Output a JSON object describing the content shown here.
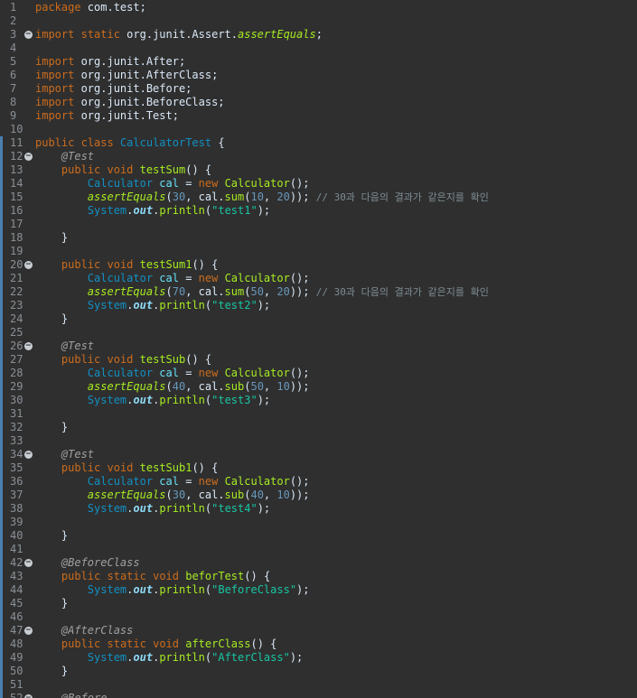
{
  "colors": {
    "keyword": "#cc6c1d",
    "plain": "#d9e8f7",
    "type": "#1290c3",
    "variable": "#66e1f8",
    "method": "#a7ec21",
    "static_method": "#a7ec21",
    "static_field": "#8ddaf8",
    "annotation": "#a0a0a0",
    "number": "#6897bb",
    "string": "#17c6a3",
    "comment": "#7d8c93",
    "line_number": "#8a9096",
    "background": "#2f2f2f",
    "fold_marker": "#c9ced3",
    "change_marker": "#4a7fb0"
  },
  "editor": {
    "lines": [
      {
        "n": "1",
        "fold": false,
        "tokens": [
          [
            "package",
            "keyword"
          ],
          [
            " com.test;",
            "plain"
          ]
        ]
      },
      {
        "n": "2",
        "fold": false,
        "tokens": []
      },
      {
        "n": "3",
        "fold": true,
        "tokens": [
          [
            "import",
            "keyword"
          ],
          [
            " ",
            "plain"
          ],
          [
            "static",
            "keyword"
          ],
          [
            " org.junit.Assert.",
            "plain"
          ],
          [
            "assertEquals",
            "static_method"
          ],
          [
            ";",
            "plain"
          ]
        ]
      },
      {
        "n": "4",
        "fold": false,
        "tokens": []
      },
      {
        "n": "5",
        "fold": false,
        "tokens": [
          [
            "import",
            "keyword"
          ],
          [
            " org.junit.After;",
            "plain"
          ]
        ]
      },
      {
        "n": "6",
        "fold": false,
        "tokens": [
          [
            "import",
            "keyword"
          ],
          [
            " org.junit.AfterClass;",
            "plain"
          ]
        ]
      },
      {
        "n": "7",
        "fold": false,
        "tokens": [
          [
            "import",
            "keyword"
          ],
          [
            " org.junit.Before;",
            "plain"
          ]
        ]
      },
      {
        "n": "8",
        "fold": false,
        "tokens": [
          [
            "import",
            "keyword"
          ],
          [
            " org.junit.BeforeClass;",
            "plain"
          ]
        ]
      },
      {
        "n": "9",
        "fold": false,
        "tokens": [
          [
            "import",
            "keyword"
          ],
          [
            " org.junit.Test;",
            "plain"
          ]
        ]
      },
      {
        "n": "10",
        "fold": false,
        "tokens": []
      },
      {
        "n": "11",
        "fold": false,
        "tokens": [
          [
            "public",
            "keyword"
          ],
          [
            " ",
            "plain"
          ],
          [
            "class",
            "keyword"
          ],
          [
            " ",
            "plain"
          ],
          [
            "CalculatorTest",
            "type"
          ],
          [
            " {",
            "plain"
          ]
        ]
      },
      {
        "n": "12",
        "fold": true,
        "tokens": [
          [
            "    ",
            "plain"
          ],
          [
            "@Test",
            "annotation"
          ]
        ]
      },
      {
        "n": "13",
        "fold": false,
        "tokens": [
          [
            "    ",
            "plain"
          ],
          [
            "public",
            "keyword"
          ],
          [
            " ",
            "plain"
          ],
          [
            "void",
            "keyword"
          ],
          [
            " ",
            "plain"
          ],
          [
            "testSum",
            "method"
          ],
          [
            "() {",
            "plain"
          ]
        ]
      },
      {
        "n": "14",
        "fold": false,
        "tokens": [
          [
            "        ",
            "plain"
          ],
          [
            "Calculator",
            "type"
          ],
          [
            " ",
            "plain"
          ],
          [
            "cal",
            "variable"
          ],
          [
            " = ",
            "plain"
          ],
          [
            "new",
            "keyword"
          ],
          [
            " ",
            "plain"
          ],
          [
            "Calculator",
            "method"
          ],
          [
            "();",
            "plain"
          ]
        ]
      },
      {
        "n": "15",
        "fold": false,
        "tokens": [
          [
            "        ",
            "plain"
          ],
          [
            "assertEquals",
            "static_method"
          ],
          [
            "(",
            "plain"
          ],
          [
            "30",
            "number"
          ],
          [
            ", cal.",
            "plain"
          ],
          [
            "sum",
            "method"
          ],
          [
            "(",
            "plain"
          ],
          [
            "10",
            "number"
          ],
          [
            ", ",
            "plain"
          ],
          [
            "20",
            "number"
          ],
          [
            ")); ",
            "plain"
          ],
          [
            "// 30과 다음의 결과가 같은지를 확인",
            "comment"
          ]
        ]
      },
      {
        "n": "16",
        "fold": false,
        "tokens": [
          [
            "        ",
            "plain"
          ],
          [
            "System",
            "type"
          ],
          [
            ".",
            "plain"
          ],
          [
            "out",
            "static_field"
          ],
          [
            ".",
            "plain"
          ],
          [
            "println",
            "method"
          ],
          [
            "(",
            "plain"
          ],
          [
            "\"test1\"",
            "string"
          ],
          [
            ");",
            "plain"
          ]
        ]
      },
      {
        "n": "17",
        "fold": false,
        "tokens": []
      },
      {
        "n": "18",
        "fold": false,
        "tokens": [
          [
            "    }",
            "plain"
          ]
        ]
      },
      {
        "n": "19",
        "fold": false,
        "tokens": []
      },
      {
        "n": "20",
        "fold": true,
        "tokens": [
          [
            "    ",
            "plain"
          ],
          [
            "public",
            "keyword"
          ],
          [
            " ",
            "plain"
          ],
          [
            "void",
            "keyword"
          ],
          [
            " ",
            "plain"
          ],
          [
            "testSum1",
            "method"
          ],
          [
            "() {",
            "plain"
          ]
        ]
      },
      {
        "n": "21",
        "fold": false,
        "tokens": [
          [
            "        ",
            "plain"
          ],
          [
            "Calculator",
            "type"
          ],
          [
            " ",
            "plain"
          ],
          [
            "cal",
            "variable"
          ],
          [
            " = ",
            "plain"
          ],
          [
            "new",
            "keyword"
          ],
          [
            " ",
            "plain"
          ],
          [
            "Calculator",
            "method"
          ],
          [
            "();",
            "plain"
          ]
        ]
      },
      {
        "n": "22",
        "fold": false,
        "tokens": [
          [
            "        ",
            "plain"
          ],
          [
            "assertEquals",
            "static_method"
          ],
          [
            "(",
            "plain"
          ],
          [
            "70",
            "number"
          ],
          [
            ", cal.",
            "plain"
          ],
          [
            "sum",
            "method"
          ],
          [
            "(",
            "plain"
          ],
          [
            "50",
            "number"
          ],
          [
            ", ",
            "plain"
          ],
          [
            "20",
            "number"
          ],
          [
            ")); ",
            "plain"
          ],
          [
            "// 30과 다음의 결과가 같은지를 확인",
            "comment"
          ]
        ]
      },
      {
        "n": "23",
        "fold": false,
        "tokens": [
          [
            "        ",
            "plain"
          ],
          [
            "System",
            "type"
          ],
          [
            ".",
            "plain"
          ],
          [
            "out",
            "static_field"
          ],
          [
            ".",
            "plain"
          ],
          [
            "println",
            "method"
          ],
          [
            "(",
            "plain"
          ],
          [
            "\"test2\"",
            "string"
          ],
          [
            ");",
            "plain"
          ]
        ]
      },
      {
        "n": "24",
        "fold": false,
        "tokens": [
          [
            "    }",
            "plain"
          ]
        ]
      },
      {
        "n": "25",
        "fold": false,
        "tokens": []
      },
      {
        "n": "26",
        "fold": true,
        "tokens": [
          [
            "    ",
            "plain"
          ],
          [
            "@Test",
            "annotation"
          ]
        ]
      },
      {
        "n": "27",
        "fold": false,
        "tokens": [
          [
            "    ",
            "plain"
          ],
          [
            "public",
            "keyword"
          ],
          [
            " ",
            "plain"
          ],
          [
            "void",
            "keyword"
          ],
          [
            " ",
            "plain"
          ],
          [
            "testSub",
            "method"
          ],
          [
            "() {",
            "plain"
          ]
        ]
      },
      {
        "n": "28",
        "fold": false,
        "tokens": [
          [
            "        ",
            "plain"
          ],
          [
            "Calculator",
            "type"
          ],
          [
            " ",
            "plain"
          ],
          [
            "cal",
            "variable"
          ],
          [
            " = ",
            "plain"
          ],
          [
            "new",
            "keyword"
          ],
          [
            " ",
            "plain"
          ],
          [
            "Calculator",
            "method"
          ],
          [
            "();",
            "plain"
          ]
        ]
      },
      {
        "n": "29",
        "fold": false,
        "tokens": [
          [
            "        ",
            "plain"
          ],
          [
            "assertEquals",
            "static_method"
          ],
          [
            "(",
            "plain"
          ],
          [
            "40",
            "number"
          ],
          [
            ", cal.",
            "plain"
          ],
          [
            "sub",
            "method"
          ],
          [
            "(",
            "plain"
          ],
          [
            "50",
            "number"
          ],
          [
            ", ",
            "plain"
          ],
          [
            "10",
            "number"
          ],
          [
            "));",
            "plain"
          ]
        ]
      },
      {
        "n": "30",
        "fold": false,
        "tokens": [
          [
            "        ",
            "plain"
          ],
          [
            "System",
            "type"
          ],
          [
            ".",
            "plain"
          ],
          [
            "out",
            "static_field"
          ],
          [
            ".",
            "plain"
          ],
          [
            "println",
            "method"
          ],
          [
            "(",
            "plain"
          ],
          [
            "\"test3\"",
            "string"
          ],
          [
            ");",
            "plain"
          ]
        ]
      },
      {
        "n": "31",
        "fold": false,
        "tokens": []
      },
      {
        "n": "32",
        "fold": false,
        "tokens": [
          [
            "    }",
            "plain"
          ]
        ]
      },
      {
        "n": "33",
        "fold": false,
        "tokens": []
      },
      {
        "n": "34",
        "fold": true,
        "tokens": [
          [
            "    ",
            "plain"
          ],
          [
            "@Test",
            "annotation"
          ]
        ]
      },
      {
        "n": "35",
        "fold": false,
        "tokens": [
          [
            "    ",
            "plain"
          ],
          [
            "public",
            "keyword"
          ],
          [
            " ",
            "plain"
          ],
          [
            "void",
            "keyword"
          ],
          [
            " ",
            "plain"
          ],
          [
            "testSub1",
            "method"
          ],
          [
            "() {",
            "plain"
          ]
        ]
      },
      {
        "n": "36",
        "fold": false,
        "tokens": [
          [
            "        ",
            "plain"
          ],
          [
            "Calculator",
            "type"
          ],
          [
            " ",
            "plain"
          ],
          [
            "cal",
            "variable"
          ],
          [
            " = ",
            "plain"
          ],
          [
            "new",
            "keyword"
          ],
          [
            " ",
            "plain"
          ],
          [
            "Calculator",
            "method"
          ],
          [
            "();",
            "plain"
          ]
        ]
      },
      {
        "n": "37",
        "fold": false,
        "tokens": [
          [
            "        ",
            "plain"
          ],
          [
            "assertEquals",
            "static_method"
          ],
          [
            "(",
            "plain"
          ],
          [
            "30",
            "number"
          ],
          [
            ", cal.",
            "plain"
          ],
          [
            "sub",
            "method"
          ],
          [
            "(",
            "plain"
          ],
          [
            "40",
            "number"
          ],
          [
            ", ",
            "plain"
          ],
          [
            "10",
            "number"
          ],
          [
            "));",
            "plain"
          ]
        ]
      },
      {
        "n": "38",
        "fold": false,
        "tokens": [
          [
            "        ",
            "plain"
          ],
          [
            "System",
            "type"
          ],
          [
            ".",
            "plain"
          ],
          [
            "out",
            "static_field"
          ],
          [
            ".",
            "plain"
          ],
          [
            "println",
            "method"
          ],
          [
            "(",
            "plain"
          ],
          [
            "\"test4\"",
            "string"
          ],
          [
            ");",
            "plain"
          ]
        ]
      },
      {
        "n": "39",
        "fold": false,
        "tokens": []
      },
      {
        "n": "40",
        "fold": false,
        "tokens": [
          [
            "    }",
            "plain"
          ]
        ]
      },
      {
        "n": "41",
        "fold": false,
        "tokens": []
      },
      {
        "n": "42",
        "fold": true,
        "tokens": [
          [
            "    ",
            "plain"
          ],
          [
            "@BeforeClass",
            "annotation"
          ]
        ]
      },
      {
        "n": "43",
        "fold": false,
        "tokens": [
          [
            "    ",
            "plain"
          ],
          [
            "public",
            "keyword"
          ],
          [
            " ",
            "plain"
          ],
          [
            "static",
            "keyword"
          ],
          [
            " ",
            "plain"
          ],
          [
            "void",
            "keyword"
          ],
          [
            " ",
            "plain"
          ],
          [
            "beforTest",
            "method"
          ],
          [
            "() {",
            "plain"
          ]
        ]
      },
      {
        "n": "44",
        "fold": false,
        "tokens": [
          [
            "        ",
            "plain"
          ],
          [
            "System",
            "type"
          ],
          [
            ".",
            "plain"
          ],
          [
            "out",
            "static_field"
          ],
          [
            ".",
            "plain"
          ],
          [
            "println",
            "method"
          ],
          [
            "(",
            "plain"
          ],
          [
            "\"BeforeClass\"",
            "string"
          ],
          [
            ");",
            "plain"
          ]
        ]
      },
      {
        "n": "45",
        "fold": false,
        "tokens": [
          [
            "    }",
            "plain"
          ]
        ]
      },
      {
        "n": "46",
        "fold": false,
        "tokens": []
      },
      {
        "n": "47",
        "fold": true,
        "tokens": [
          [
            "    ",
            "plain"
          ],
          [
            "@AfterClass",
            "annotation"
          ]
        ]
      },
      {
        "n": "48",
        "fold": false,
        "tokens": [
          [
            "    ",
            "plain"
          ],
          [
            "public",
            "keyword"
          ],
          [
            " ",
            "plain"
          ],
          [
            "static",
            "keyword"
          ],
          [
            " ",
            "plain"
          ],
          [
            "void",
            "keyword"
          ],
          [
            " ",
            "plain"
          ],
          [
            "afterClass",
            "method"
          ],
          [
            "() {",
            "plain"
          ]
        ]
      },
      {
        "n": "49",
        "fold": false,
        "tokens": [
          [
            "        ",
            "plain"
          ],
          [
            "System",
            "type"
          ],
          [
            ".",
            "plain"
          ],
          [
            "out",
            "static_field"
          ],
          [
            ".",
            "plain"
          ],
          [
            "println",
            "method"
          ],
          [
            "(",
            "plain"
          ],
          [
            "\"AfterClass\"",
            "string"
          ],
          [
            ");",
            "plain"
          ]
        ]
      },
      {
        "n": "50",
        "fold": false,
        "tokens": [
          [
            "    }",
            "plain"
          ]
        ]
      },
      {
        "n": "51",
        "fold": false,
        "tokens": []
      },
      {
        "n": "52",
        "fold": true,
        "tokens": [
          [
            "    ",
            "plain"
          ],
          [
            "@Before",
            "annotation"
          ]
        ]
      }
    ]
  }
}
